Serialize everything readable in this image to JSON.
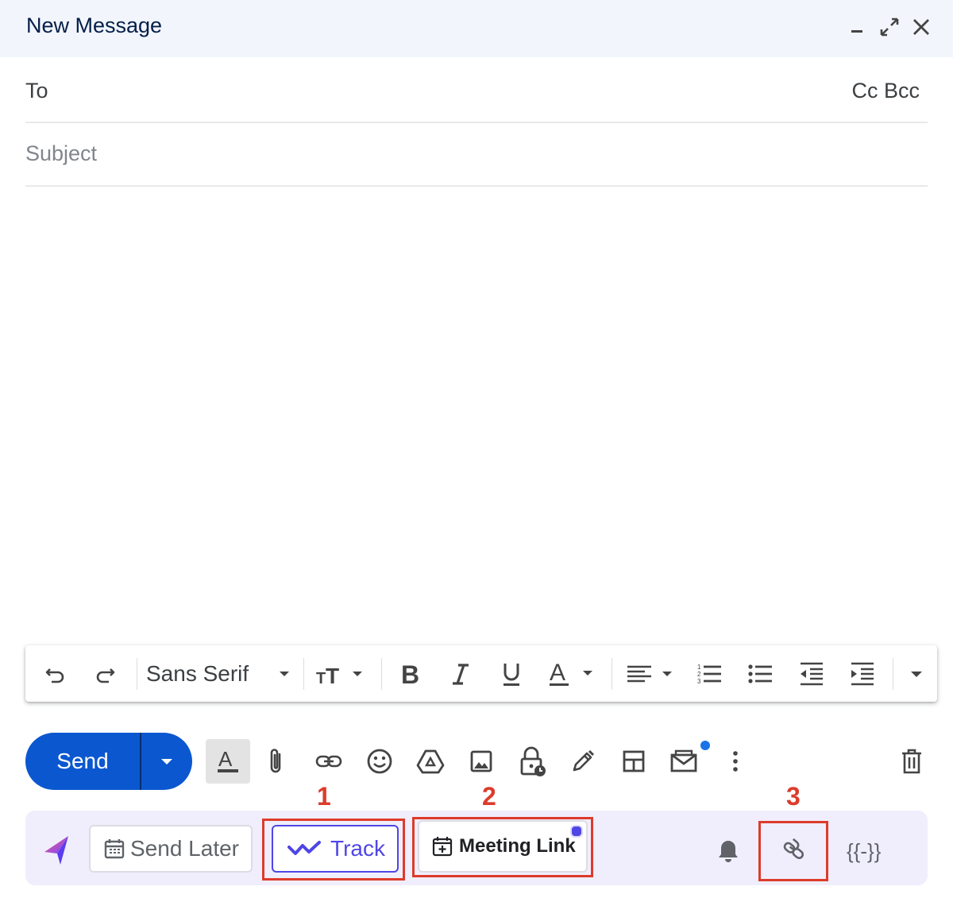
{
  "window": {
    "title": "New Message"
  },
  "recipients": {
    "to_label": "To",
    "cc_label": "Cc",
    "bcc_label": "Bcc"
  },
  "subject": {
    "placeholder": "Subject",
    "value": ""
  },
  "formatting": {
    "font_family": "Sans Serif",
    "tools": [
      "undo-icon",
      "redo-icon",
      "font-family-select",
      "text-size-icon",
      "bold-icon",
      "italic-icon",
      "underline-icon",
      "text-color-icon",
      "align-icon",
      "numbered-list-icon",
      "bulleted-list-icon",
      "indent-less-icon",
      "indent-more-icon",
      "more-formatting-icon"
    ]
  },
  "send": {
    "label": "Send"
  },
  "toolbar_icons": [
    "formatting-options-icon",
    "attach-icon",
    "insert-link-icon",
    "emoji-icon",
    "drive-icon",
    "insert-photo-icon",
    "confidential-mode-icon",
    "signature-icon",
    "layouts-icon",
    "template-icon",
    "more-options-icon",
    "discard-draft-icon"
  ],
  "extension": {
    "send_later_label": "Send Later",
    "track_label": "Track",
    "meeting_link_label": "Meeting Link",
    "merge_tag_label": "{{-}}"
  },
  "annotations": [
    "1",
    "2",
    "3"
  ],
  "colors": {
    "primary": "#0b57d0",
    "accent_purple": "#4f46e5",
    "annotation_red": "#dd3b2b",
    "title_bar": "#f2f6fc",
    "extension_bar": "#f0eefc"
  }
}
